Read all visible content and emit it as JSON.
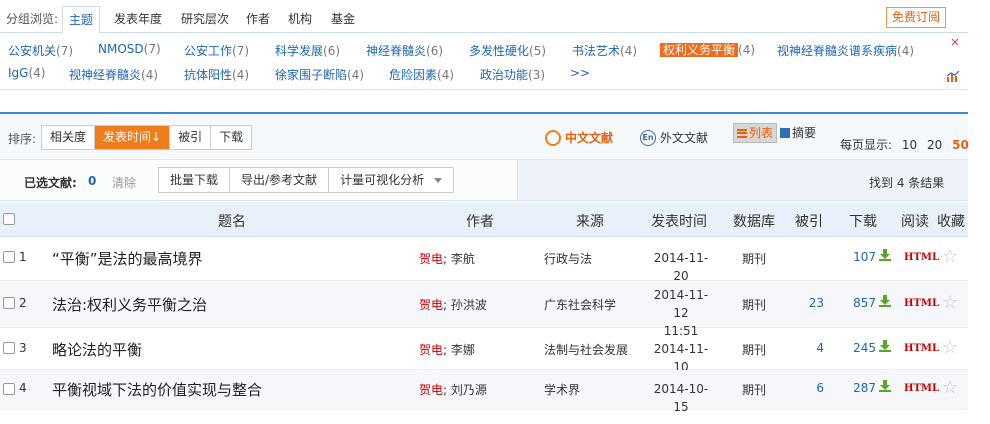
{
  "group_bar": {
    "label": "分组浏览:",
    "tabs": [
      "主题",
      "发表年度",
      "研究层次",
      "作者",
      "机构",
      "基金"
    ],
    "active_tab": "主题",
    "subscribe": "免费订阅"
  },
  "keywords": [
    {
      "text": "公安机关",
      "count": "(7)"
    },
    {
      "text": "NMOSD",
      "count": "(7)"
    },
    {
      "text": "公安工作",
      "count": "(7)"
    },
    {
      "text": "科学发展",
      "count": "(6)"
    },
    {
      "text": "神经脊髓炎",
      "count": "(6)"
    },
    {
      "text": "多发性硬化",
      "count": "(5)"
    },
    {
      "text": "书法艺术",
      "count": "(4)"
    },
    {
      "text": "权利义务平衡",
      "count": "(4)",
      "highlighted": true
    },
    {
      "text": "视神经脊髓炎谱系疾病",
      "count": "(4)"
    },
    {
      "text": "IgG",
      "count": "(4)"
    },
    {
      "text": "视神经脊髓炎",
      "count": "(4)"
    },
    {
      "text": "抗体阳性",
      "count": "(4)"
    },
    {
      "text": "徐家围子断陷",
      "count": "(4)"
    },
    {
      "text": "危险因素",
      "count": "(4)"
    },
    {
      "text": "政治功能",
      "count": "(3)"
    },
    {
      "text": ">>",
      "count": ""
    }
  ],
  "keyword_close": "×",
  "sort": {
    "label": "排序:",
    "options": [
      "相关度",
      "发表时间",
      "被引",
      "下载"
    ],
    "active": "发表时间",
    "active_arrow": "↓"
  },
  "language": {
    "zh": "中文文献",
    "en": "外文文献",
    "en_icon_text": "En"
  },
  "view": {
    "list": "列表",
    "abstract": "摘要",
    "active": "list"
  },
  "per_page": {
    "label": "每页显示:",
    "options": [
      "10",
      "20",
      "50"
    ],
    "active": "50"
  },
  "selection": {
    "label": "已选文献:",
    "count": "0",
    "clear": "清除",
    "actions": [
      "批量下载",
      "导出/参考文献",
      "计量可视化分析"
    ]
  },
  "found": "找到 4 条结果",
  "table": {
    "headers": {
      "title": "题名",
      "author": "作者",
      "source": "来源",
      "date": "发表时间",
      "db": "数据库",
      "cite": "被引",
      "download": "下载",
      "read": "阅读",
      "fav": "收藏"
    },
    "rows": [
      {
        "num": "1",
        "title": "“平衡”是法的最高境界",
        "author1": "贺电",
        "author2": "李航",
        "source": "行政与法",
        "date": "2014-11-20",
        "date2": "",
        "db": "期刊",
        "cite": "",
        "download": "107",
        "read": "HTML"
      },
      {
        "num": "2",
        "title": "法治:权利义务平衡之治",
        "author1": "贺电",
        "author2": "孙洪波",
        "source": "广东社会科学",
        "date": "2014-11-12",
        "date2": "11:51",
        "db": "期刊",
        "cite": "23",
        "download": "857",
        "read": "HTML"
      },
      {
        "num": "3",
        "title": "略论法的平衡",
        "author1": "贺电",
        "author2": "李娜",
        "source": "法制与社会发展",
        "date": "2014-11-10",
        "date2": "",
        "db": "期刊",
        "cite": "4",
        "download": "245",
        "read": "HTML"
      },
      {
        "num": "4",
        "title": "平衡视域下法的价值实现与整合",
        "author1": "贺电",
        "author2": "刘乃源",
        "source": "学术界",
        "date": "2014-10-15",
        "date2": "",
        "db": "期刊",
        "cite": "6",
        "download": "287",
        "read": "HTML"
      }
    ]
  },
  "colors": {
    "accent": "#f07d1c",
    "link": "#1c66b6",
    "author": "#cc0000"
  }
}
